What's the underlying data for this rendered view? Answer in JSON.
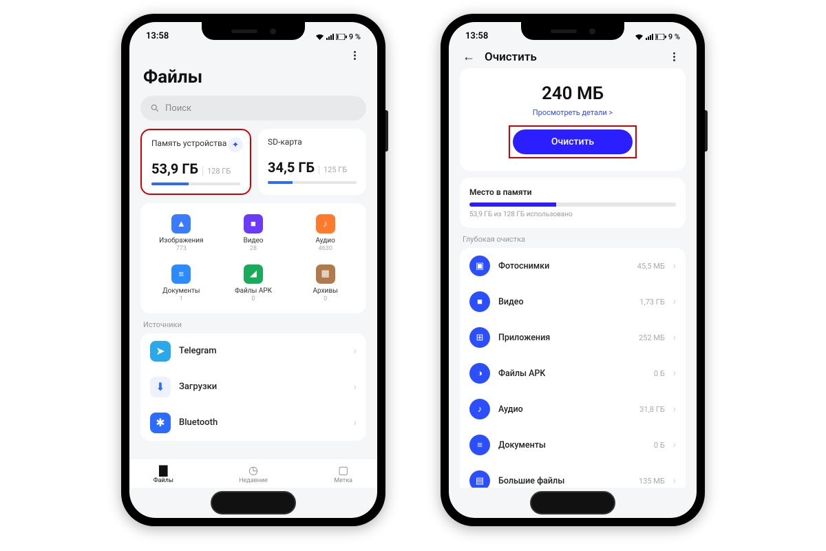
{
  "status": {
    "time": "13:58",
    "battery": "9 %"
  },
  "screen1": {
    "title": "Файлы",
    "search_placeholder": "Поиск",
    "storage": [
      {
        "label": "Память устройства",
        "used": "53,9 ГБ",
        "total": "128 ГБ",
        "pct": 42,
        "has_clean": true
      },
      {
        "label": "SD-карта",
        "used": "34,5 ГБ",
        "total": "125 ГБ",
        "pct": 28,
        "has_clean": false
      }
    ],
    "categories": [
      {
        "name": "Изображения",
        "count": "773",
        "color": "#3b7bff",
        "glyph": "▲"
      },
      {
        "name": "Видео",
        "count": "28",
        "color": "#6a3bff",
        "glyph": "■"
      },
      {
        "name": "Аудио",
        "count": "4630",
        "color": "#ff7a2b",
        "glyph": "♪"
      },
      {
        "name": "Документы",
        "count": "1",
        "color": "#2b8bff",
        "glyph": "≡"
      },
      {
        "name": "Файлы APK",
        "count": "0",
        "color": "#1aab5a",
        "glyph": "◢"
      },
      {
        "name": "Архивы",
        "count": "0",
        "color": "#b07a4a",
        "glyph": "▦"
      }
    ],
    "sources_label": "Источники",
    "sources": [
      {
        "name": "Telegram",
        "color": "#2ba8e8",
        "glyph": "➤"
      },
      {
        "name": "Загрузки",
        "color": "#eef1ff",
        "fg": "#2b6bff",
        "glyph": "⬇"
      },
      {
        "name": "Bluetooth",
        "color": "#2b6bff",
        "glyph": "✱"
      }
    ],
    "nav": [
      {
        "label": "Файлы",
        "glyph": "▇",
        "active": true
      },
      {
        "label": "Недавние",
        "glyph": "◷",
        "active": false
      },
      {
        "label": "Метка",
        "glyph": "▢",
        "active": false
      }
    ]
  },
  "screen2": {
    "title": "Очистить",
    "amount": "240 МБ",
    "details_link": "Просмотреть детали >",
    "button": "Очистить",
    "memory": {
      "title": "Место в памяти",
      "text": "53,9 ГБ из 128 ГБ использовано",
      "pct": 42
    },
    "deep_label": "Глубокая очистка",
    "deep": [
      {
        "name": "Фотоснимки",
        "size": "45,5 МБ",
        "glyph": "▣"
      },
      {
        "name": "Видео",
        "size": "1,73 ГБ",
        "glyph": "■"
      },
      {
        "name": "Приложения",
        "size": "252 МБ",
        "glyph": "⊞"
      },
      {
        "name": "Файлы APK",
        "size": "0 Б",
        "glyph": "◑"
      },
      {
        "name": "Аудио",
        "size": "31,8 ГБ",
        "glyph": "♪"
      },
      {
        "name": "Документы",
        "size": "0 Б",
        "glyph": "≡"
      },
      {
        "name": "Большие файлы",
        "size": "135 МБ",
        "glyph": "▤"
      }
    ]
  }
}
